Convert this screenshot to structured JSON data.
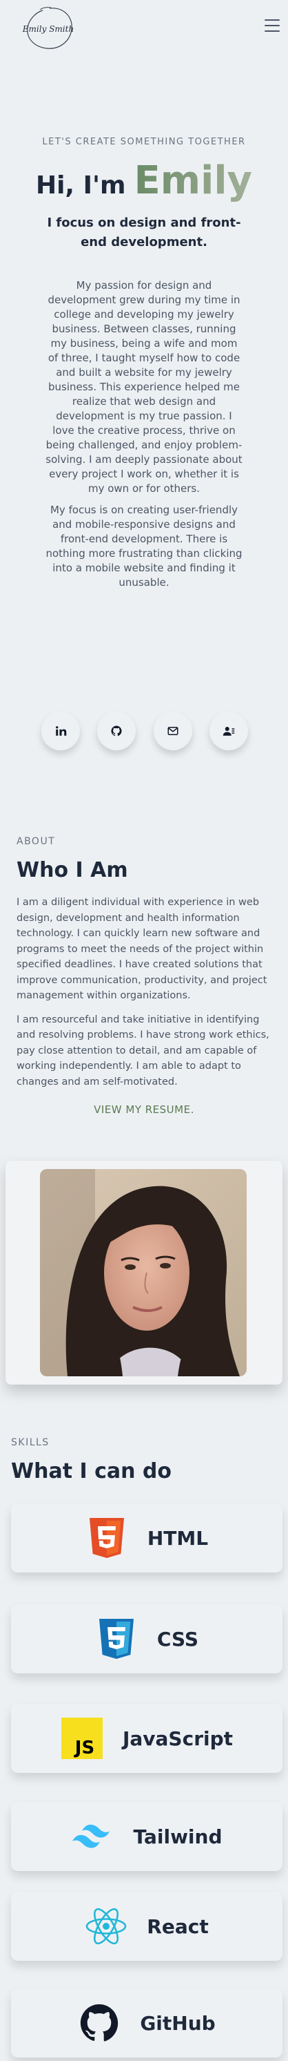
{
  "header": {
    "logo_text": "Emily Smith",
    "menu_icon": "hamburger-menu-icon"
  },
  "hero": {
    "eyebrow": "LET'S CREATE SOMETHING TOGETHER",
    "greeting": "Hi, I'm",
    "name": "Emily",
    "tagline": "I focus on design and front-end development.",
    "paragraph1": "My passion for design and development grew during my time in college and developing my jewelry business. Between classes, running my business, being a wife and mom of three, I taught myself how to code and built a website for my jewelry business. This experience helped me realize that web design and development is my true passion. I love the creative process, thrive on being challenged, and enjoy problem-solving. I am deeply passionate about every project I work on, whether it is my own or for others.",
    "paragraph2": "My focus is on creating user-friendly and mobile-responsive designs and front-end development. There is nothing more frustrating than clicking into a mobile website and finding it unusable."
  },
  "socials": [
    {
      "icon": "linkedin-icon"
    },
    {
      "icon": "github-icon"
    },
    {
      "icon": "mail-icon"
    },
    {
      "icon": "contact-icon"
    }
  ],
  "about": {
    "eyebrow": "ABOUT",
    "title": "Who I Am",
    "paragraph1": "I am a diligent individual with experience in web design, development and health information technology. I can quickly learn new software and programs to meet the needs of the project within specified deadlines. I have created solutions that improve communication, productivity, and project management within organizations.",
    "paragraph2": "I am resourceful and take initiative in identifying and resolving problems. I have strong work ethics, pay close attention to detail, and am capable of working independently. I am able to adapt to changes and am self-motivated.",
    "resume_link": "VIEW MY RESUME."
  },
  "skills": {
    "eyebrow": "SKILLS",
    "title": "What I can do",
    "items": [
      {
        "label": "HTML",
        "icon": "html5-icon"
      },
      {
        "label": "CSS",
        "icon": "css3-icon"
      },
      {
        "label": "JavaScript",
        "icon": "javascript-icon"
      },
      {
        "label": "Tailwind",
        "icon": "tailwind-icon"
      },
      {
        "label": "React",
        "icon": "react-icon"
      },
      {
        "label": "GitHub",
        "icon": "github-icon"
      }
    ]
  },
  "colors": {
    "background": "#edf0f3",
    "accent": "#7d9b76",
    "heading": "#1e293b",
    "body_text": "#4b5563"
  }
}
